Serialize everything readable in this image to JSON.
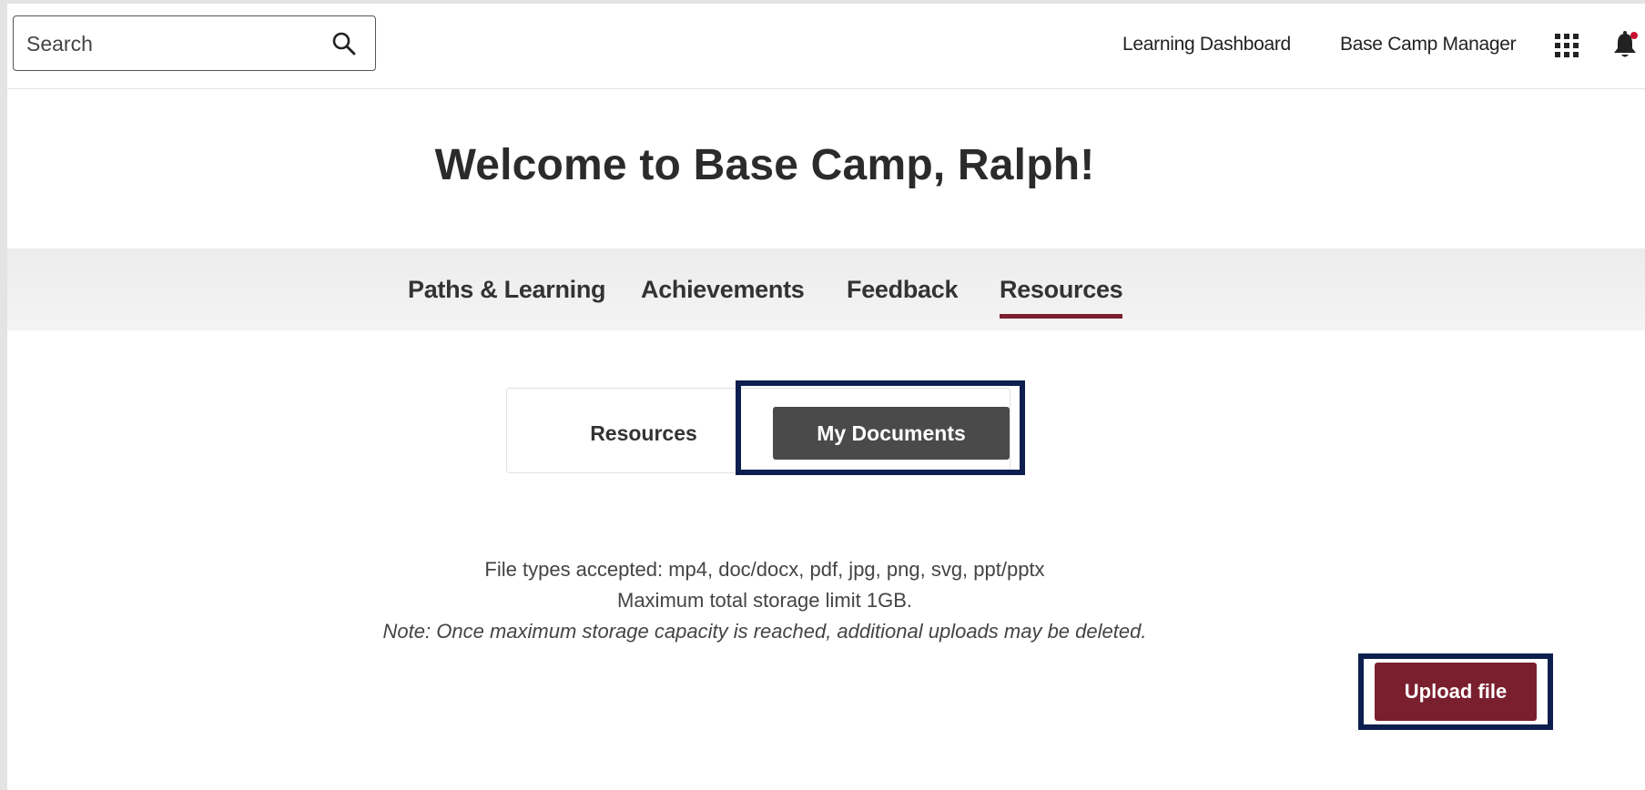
{
  "search": {
    "placeholder": "Search"
  },
  "header": {
    "links": [
      "Learning Dashboard",
      "Base Camp Manager"
    ],
    "accent_color": "#7a1f2e",
    "notification_dot_color": "#c8102e"
  },
  "welcome": {
    "title": "Welcome to Base Camp, Ralph!"
  },
  "main_tabs": [
    {
      "label": "Paths & Learning",
      "active": false
    },
    {
      "label": "Achievements",
      "active": false
    },
    {
      "label": "Feedback",
      "active": false
    },
    {
      "label": "Resources",
      "active": true
    }
  ],
  "sub_tabs": [
    {
      "label": "Resources",
      "selected": false
    },
    {
      "label": "My Documents",
      "selected": true
    }
  ],
  "info": {
    "file_types": "File types accepted: mp4, doc/docx, pdf, jpg, png, svg, ppt/pptx",
    "storage_limit": "Maximum total storage limit 1GB.",
    "note": "Note: Once maximum storage capacity is reached, additional uploads may be deleted."
  },
  "upload": {
    "label": "Upload file"
  },
  "icons": [
    "search-icon",
    "apps-grid-icon",
    "bell-icon"
  ],
  "highlight_color": "#0d1f4e"
}
